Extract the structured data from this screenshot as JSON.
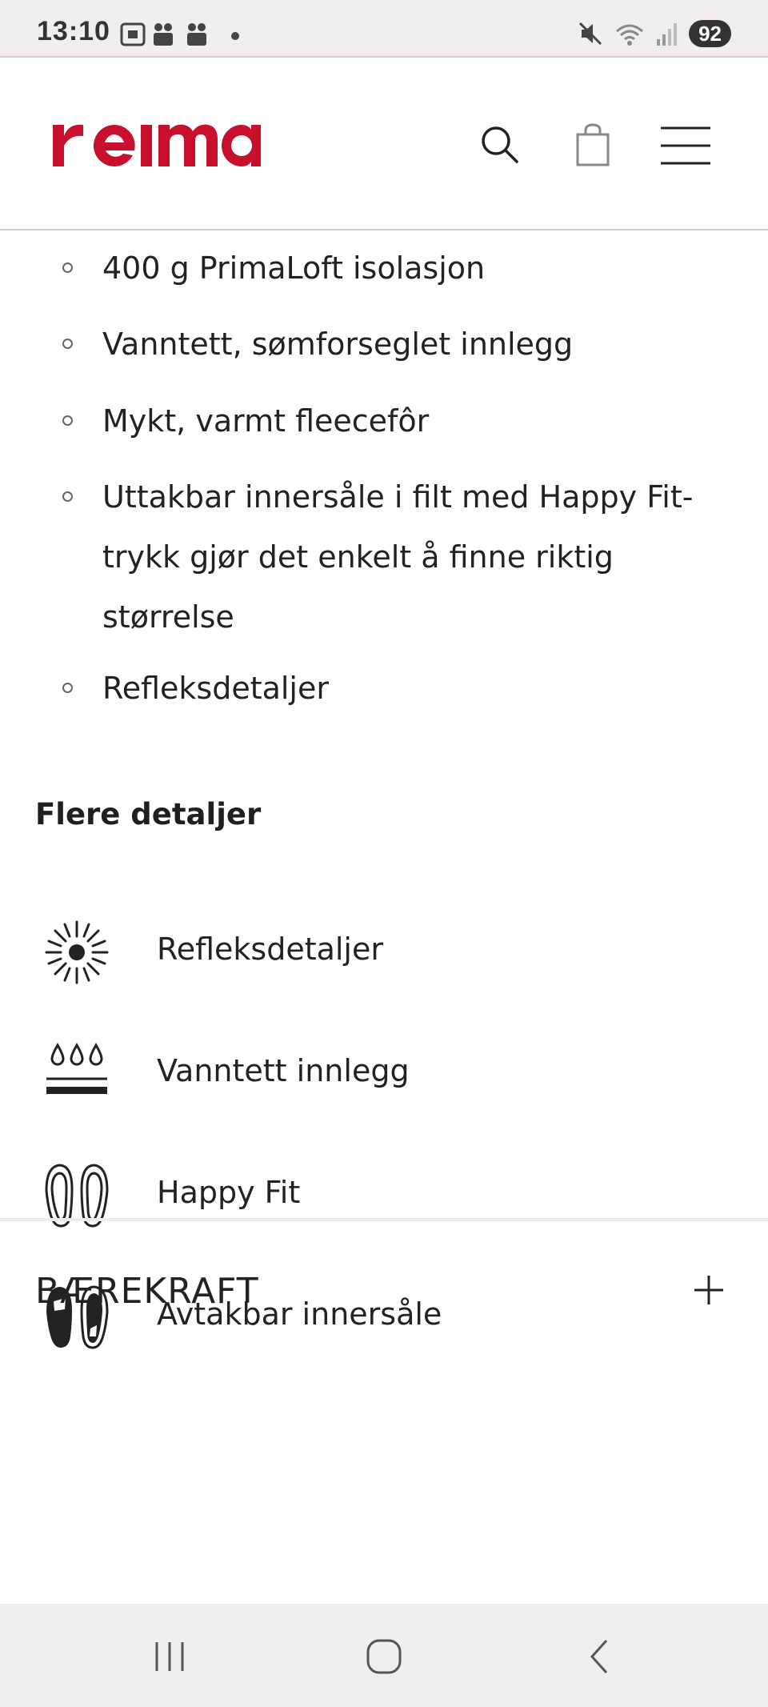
{
  "status_bar": {
    "time": "13:10",
    "battery": "92"
  },
  "header": {
    "brand": "reima",
    "brand_color": "#c8102e"
  },
  "bullets": [
    "400 g PrimaLoft isolasjon",
    "Vanntett, sømforseglet innlegg",
    "Mykt, varmt fleecefôr",
    "Uttakbar innersåle i filt med Happy Fit-trykk gjør det enkelt å finne riktig størrelse",
    "Refleksdetaljer"
  ],
  "details": {
    "title": "Flere detaljer",
    "features": [
      {
        "label": "Refleksdetaljer",
        "icon": "reflector-icon"
      },
      {
        "label": "Vanntett innlegg",
        "icon": "waterproof-icon"
      },
      {
        "label": "Happy Fit",
        "icon": "happy-fit-icon"
      },
      {
        "label": "Avtakbar innersåle",
        "icon": "removable-insole-icon"
      }
    ]
  },
  "accordion": {
    "title": "BÆREKRAFT",
    "toggle": "+"
  }
}
